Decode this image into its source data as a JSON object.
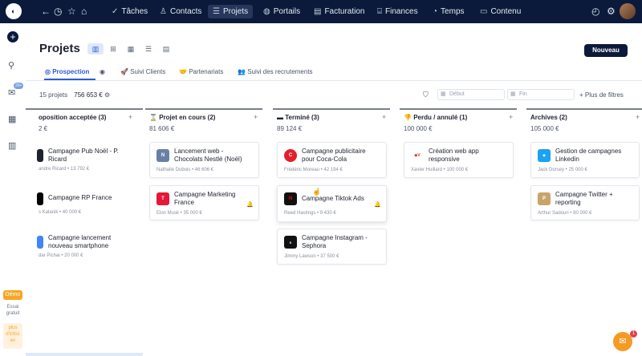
{
  "topnav": {
    "items": [
      {
        "label": "Tâches",
        "icon": "check-icon"
      },
      {
        "label": "Contacts",
        "icon": "person-icon"
      },
      {
        "label": "Projets",
        "icon": "list-icon",
        "active": true
      },
      {
        "label": "Portails",
        "icon": "globe-icon"
      },
      {
        "label": "Facturation",
        "icon": "document-icon"
      },
      {
        "label": "Finances",
        "icon": "bank-icon"
      },
      {
        "label": "Temps",
        "icon": "clock-icon"
      },
      {
        "label": "Contenu",
        "icon": "folder-icon"
      }
    ]
  },
  "sidebar": {
    "mail_badge": "20+",
    "demo_label": "Démo",
    "trial_label": "Essai gratuit",
    "more_label": "plus d'infos en"
  },
  "page": {
    "title": "Projets",
    "new_button": "Nouveau"
  },
  "tabs": [
    {
      "label": "Prospection",
      "active": true
    },
    {
      "label": "Suivi Clients"
    },
    {
      "label": "Partenariats"
    },
    {
      "label": "Suivi des recrutements"
    }
  ],
  "stats": {
    "count": "15 projets",
    "amount": "756 653 €"
  },
  "filters": {
    "start_placeholder": "Début",
    "end_placeholder": "Fin",
    "more_label": "Plus de filtres"
  },
  "columns": [
    {
      "title": "oposition acceptée (3)",
      "total": "2 €",
      "cards": [
        {
          "title": "Campagne Pub Noël - P. Ricard",
          "sub": "andre Ricard • 13 792 €",
          "logo_color": "#1f2330"
        },
        {
          "title": "Campagne RP France",
          "sub": "s Kalanik • 40 000 €",
          "logo_color": "#000000"
        },
        {
          "title": "Campagne lancement nouveau smartphone",
          "sub": "dar Pichai • 20 000 €",
          "logo_color": "#4285f4"
        }
      ]
    },
    {
      "title": "Projet en cours (2)",
      "icon": "hourglass-icon",
      "total": "81 606 €",
      "cards": [
        {
          "title": "Lancement web - Chocolats Nestlé (Noël)",
          "sub": "Nathalie Dubois • 46 606 €",
          "logo_color": "#6b7fa6"
        },
        {
          "title": "Campagne Marketing France",
          "sub": "Elon Musk • 35 000 €",
          "logo_color": "#e31937",
          "bell": true
        }
      ]
    },
    {
      "title": "Terminé (3)",
      "icon": "flag-icon",
      "total": "89 124 €",
      "cards": [
        {
          "title": "Campagne publicitaire pour Coca-Cola",
          "sub": "Frédéric Moreau • 42 194 €",
          "logo_color": "#e41e2b"
        },
        {
          "title": "Campagne Tiktok Ads",
          "sub": "Reed Hastings • 9 430 €",
          "logo_color": "#e50914",
          "bell": true
        },
        {
          "title": "Campagne Instagram - Sephora",
          "sub": "Jimmy Lawson • 37 500 €",
          "logo_color": "#111111"
        }
      ]
    },
    {
      "title": "Perdu / annulé (1)",
      "icon": "thumbs-down-icon",
      "total": "100 000 €",
      "cards": [
        {
          "title": "Création web app responsive",
          "sub": "Xavier Huillard • 100 000 €",
          "logo_color": "#d9362b"
        }
      ]
    },
    {
      "title": "Archives (2)",
      "total": "105 000 €",
      "cards": [
        {
          "title": "Gestion de campagnes Linkedin",
          "sub": "Jack Dorsey • 25 000 €",
          "logo_color": "#1da1f2"
        },
        {
          "title": "Campagne Twitter + reporting",
          "sub": "Arthur Sadoun • 80 000 €",
          "logo_color": "#c8a46a"
        }
      ]
    }
  ],
  "chat": {
    "badge": "1"
  }
}
